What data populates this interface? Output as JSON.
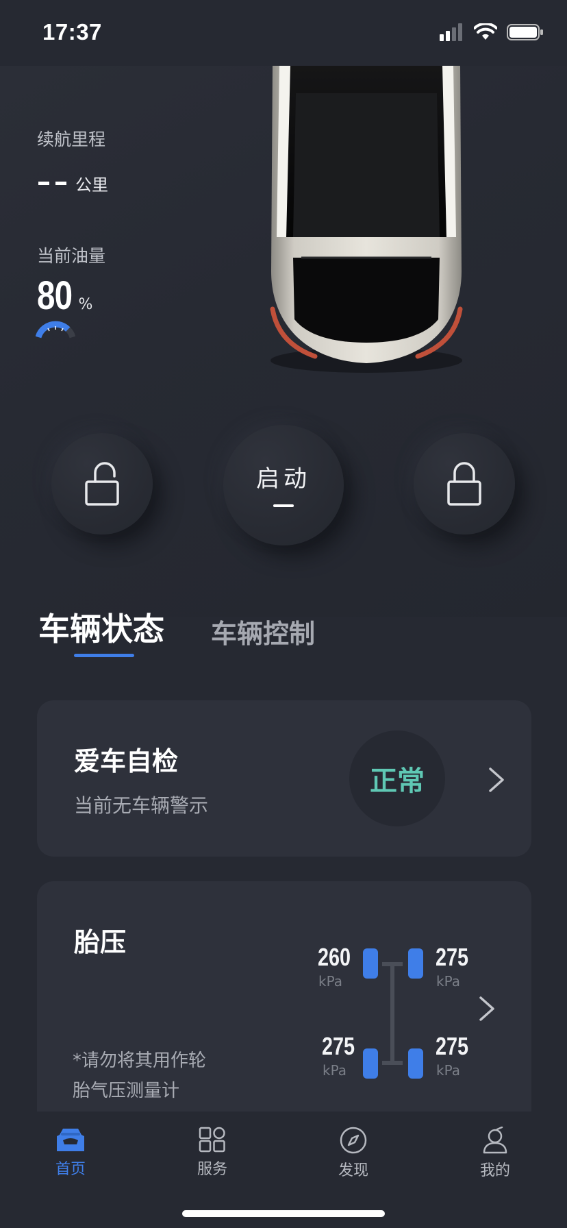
{
  "status_bar": {
    "time": "17:37"
  },
  "vehicle": {
    "range_label": "续航里程",
    "range_unit": "公里",
    "fuel_label": "当前油量",
    "fuel_value": "80",
    "fuel_unit": "%",
    "fuel_level_percent": 80
  },
  "controls": {
    "start_label": "启动"
  },
  "tabs": [
    {
      "label": "车辆状态",
      "active": true
    },
    {
      "label": "车辆控制",
      "active": false
    }
  ],
  "self_check": {
    "title": "爱车自检",
    "subtitle": "当前无车辆警示",
    "status": "正常"
  },
  "tire_pressure": {
    "title": "胎压",
    "note": "*请勿将其用作轮胎气压测量计",
    "unit": "kPa",
    "front_left": "260",
    "front_right": "275",
    "rear_left": "275",
    "rear_right": "275"
  },
  "nav": [
    {
      "label": "首页",
      "icon": "car-home-icon",
      "active": true
    },
    {
      "label": "服务",
      "icon": "grid-icon",
      "active": false
    },
    {
      "label": "发现",
      "icon": "compass-icon",
      "active": false
    },
    {
      "label": "我的",
      "icon": "user-icon",
      "active": false
    }
  ],
  "colors": {
    "accent": "#3f7ee8",
    "ok": "#5fc8b4",
    "background": "#262932",
    "card": "#2e313b"
  }
}
